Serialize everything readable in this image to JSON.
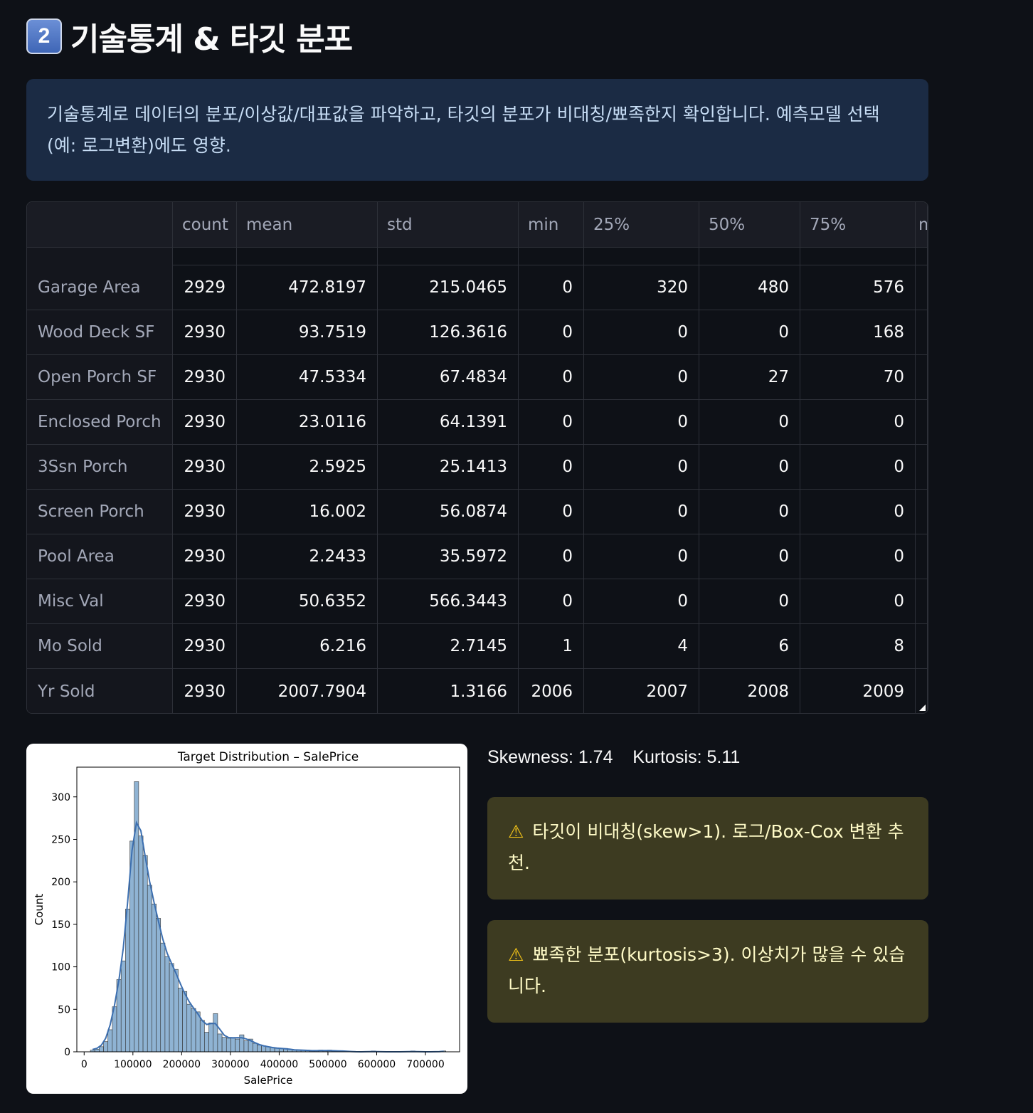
{
  "header": {
    "badge": "2",
    "title": "기술통계 & 타깃 분포"
  },
  "info": {
    "text": "기술통계로 데이터의 분포/이상값/대표값을 파악하고, 타깃의 분포가 비대칭/뾰족한지 확인합니다. 예측모델 선택(예: 로그변환)에도 영향."
  },
  "table": {
    "columns": [
      "",
      "count",
      "mean",
      "std",
      "min",
      "25%",
      "50%",
      "75%",
      "m"
    ],
    "rows": [
      [
        "Garage Area",
        "2929",
        "472.8197",
        "215.0465",
        "0",
        "320",
        "480",
        "576"
      ],
      [
        "Wood Deck SF",
        "2930",
        "93.7519",
        "126.3616",
        "0",
        "0",
        "0",
        "168"
      ],
      [
        "Open Porch SF",
        "2930",
        "47.5334",
        "67.4834",
        "0",
        "0",
        "27",
        "70"
      ],
      [
        "Enclosed Porch",
        "2930",
        "23.0116",
        "64.1391",
        "0",
        "0",
        "0",
        "0"
      ],
      [
        "3Ssn Porch",
        "2930",
        "2.5925",
        "25.1413",
        "0",
        "0",
        "0",
        "0"
      ],
      [
        "Screen Porch",
        "2930",
        "16.002",
        "56.0874",
        "0",
        "0",
        "0",
        "0"
      ],
      [
        "Pool Area",
        "2930",
        "2.2433",
        "35.5972",
        "0",
        "0",
        "0",
        "0"
      ],
      [
        "Misc Val",
        "2930",
        "50.6352",
        "566.3443",
        "0",
        "0",
        "0",
        "0"
      ],
      [
        "Mo Sold",
        "2930",
        "6.216",
        "2.7145",
        "1",
        "4",
        "6",
        "8"
      ],
      [
        "Yr Sold",
        "2930",
        "2007.7904",
        "1.3166",
        "2006",
        "2007",
        "2008",
        "2009"
      ]
    ]
  },
  "stats": {
    "text": "Skewness: 1.74    Kurtosis: 5.11"
  },
  "warnings": [
    {
      "icon": "⚠",
      "text": "타깃이 비대칭(skew>1). 로그/Box-Cox 변환 추천."
    },
    {
      "icon": "⚠",
      "text": "뾰족한 분포(kurtosis>3). 이상치가 많을 수 있습니다."
    }
  ],
  "chart_data": {
    "type": "bar",
    "title": "Target Distribution – SalePrice",
    "xlabel": "SalePrice",
    "ylabel": "Count",
    "xlim": [
      -15000,
      770000
    ],
    "ylim": [
      0,
      335
    ],
    "xticks": [
      0,
      100000,
      200000,
      300000,
      400000,
      500000,
      600000,
      700000
    ],
    "yticks": [
      0,
      50,
      100,
      150,
      200,
      250,
      300
    ],
    "bin_start": 12789,
    "bin_width": 9000,
    "values": [
      2,
      3,
      6,
      12,
      26,
      53,
      85,
      107,
      168,
      248,
      318,
      254,
      231,
      196,
      174,
      157,
      128,
      112,
      104,
      97,
      75,
      71,
      56,
      51,
      47,
      37,
      23,
      34,
      45,
      21,
      17,
      16,
      17,
      15,
      20,
      13,
      15,
      10,
      8,
      7,
      6,
      5,
      4,
      4,
      4,
      3,
      2,
      2,
      2,
      2,
      1,
      1,
      2,
      1,
      2,
      1,
      1,
      1,
      1,
      0,
      0,
      0,
      0,
      0,
      1,
      0,
      0,
      0,
      0,
      0,
      0,
      0,
      0,
      1,
      0,
      0,
      0,
      0,
      0,
      0,
      1
    ],
    "kde": true,
    "bar_color": "#8fb3d3",
    "line_color": "#3c6fb0"
  }
}
